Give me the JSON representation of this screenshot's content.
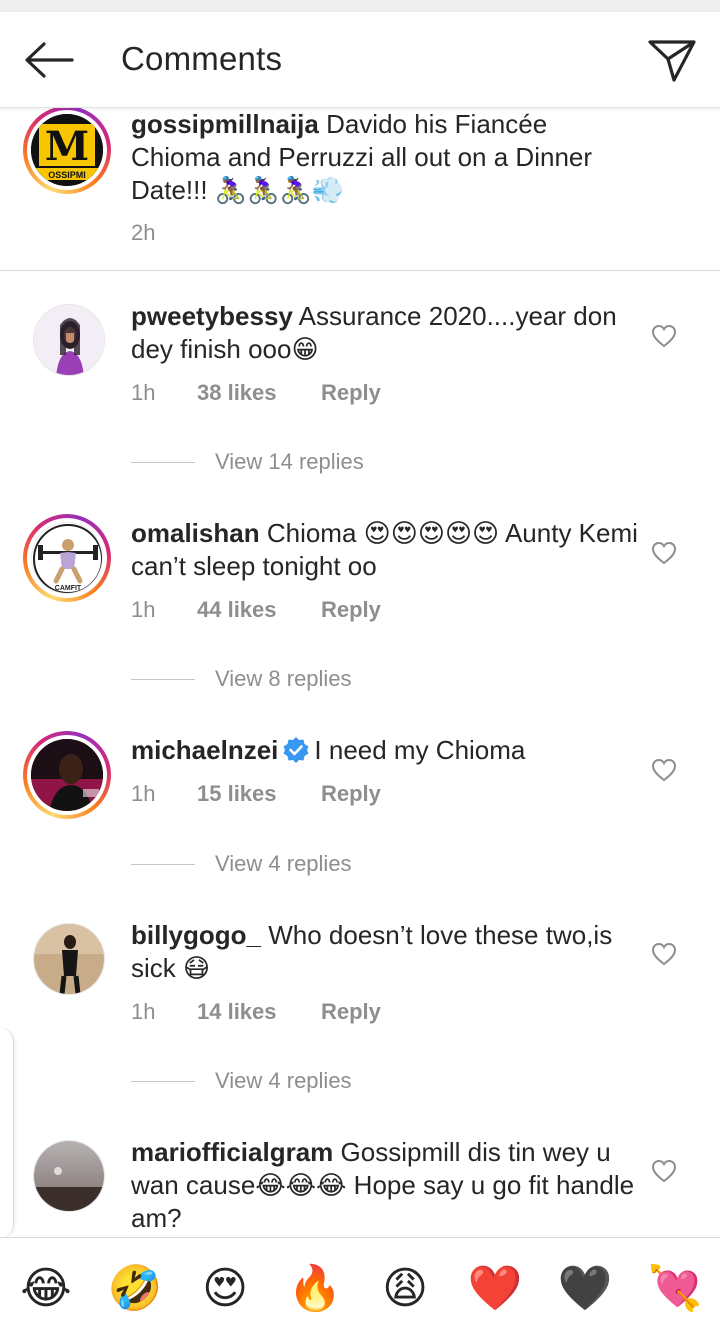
{
  "header": {
    "title": "Comments",
    "back_icon": "arrow-left-icon",
    "send_icon": "paper-plane-icon"
  },
  "caption": {
    "username": "gossipmillnaija",
    "text": "Davido his Fiancée Chioma and Perruzzi all out on a Dinner Date!!! 🚴🏾‍♀️🚴🏾‍♀️🚴🏾‍♀️💨",
    "time": "2h",
    "avatar_logo_letter": "M",
    "avatar_logo_text": "OSSIPMI"
  },
  "comments": [
    {
      "username": "pweetybessy",
      "text": "Assurance 2020....year don dey finish ooo😁",
      "time": "1h",
      "likes": "38 likes",
      "reply": "Reply",
      "view_replies": "View 14 replies"
    },
    {
      "username": "omalishan",
      "text": "Chioma 😍😍😍😍😍 Aunty Kemi can’t sleep tonight oo",
      "time": "1h",
      "likes": "44 likes",
      "reply": "Reply",
      "view_replies": "View 8 replies",
      "avatar_text": "CAMFIT"
    },
    {
      "username": "michaelnzei",
      "verified": true,
      "text": "I need my Chioma",
      "time": "1h",
      "likes": "15 likes",
      "reply": "Reply",
      "view_replies": "View 4 replies"
    },
    {
      "username": "billygogo_",
      "text": "Who doesn’t love these two,is sick 😷",
      "time": "1h",
      "likes": "14 likes",
      "reply": "Reply",
      "view_replies": "View 4 replies"
    },
    {
      "username": "mariofficialgram",
      "text": "Gossipmill dis tin wey u wan cause😂😂😂 Hope say u go fit handle am?"
    }
  ],
  "emoji_bar": [
    "😂",
    "🤣",
    "😍",
    "🔥",
    "😩",
    "❤️",
    "🖤",
    "💘"
  ],
  "colors": {
    "text": "#262626",
    "muted": "#8e8e8e",
    "verified": "#3897f0",
    "divider": "#dbdbdb"
  }
}
